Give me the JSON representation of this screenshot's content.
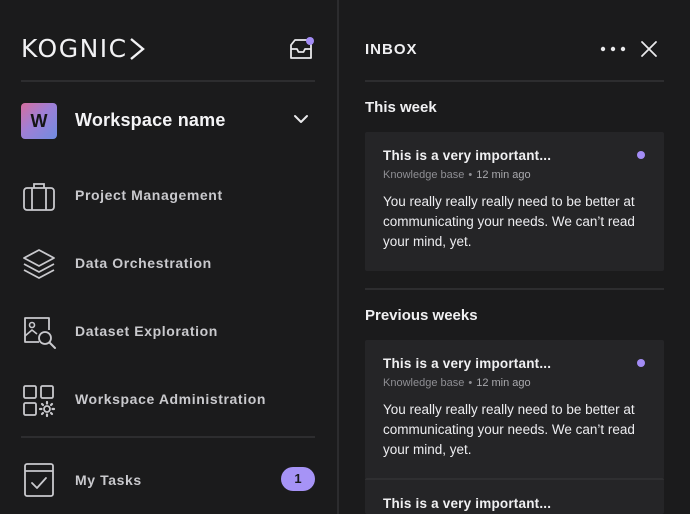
{
  "brand": {
    "logo_text": "KOGNIC"
  },
  "sidebar": {
    "workspace": {
      "initial": "W",
      "name": "Workspace name"
    },
    "nav": [
      {
        "label": "Project Management",
        "icon": "briefcase-icon"
      },
      {
        "label": "Data Orchestration",
        "icon": "layers-icon"
      },
      {
        "label": "Dataset Exploration",
        "icon": "image-search-icon"
      },
      {
        "label": "Workspace Administration",
        "icon": "grid-settings-icon"
      }
    ],
    "tasks": {
      "label": "My Tasks",
      "count": "1",
      "icon": "task-check-icon"
    }
  },
  "inbox": {
    "title": "INBOX",
    "sections": [
      {
        "title": "This week",
        "items": [
          {
            "title": "This is a very important...",
            "source": "Knowledge base",
            "separator": "•",
            "time": "12 min ago",
            "body": "You really really really need to be better at communicating your needs. We can’t read your mind, yet."
          }
        ]
      },
      {
        "title": "Previous weeks",
        "items": [
          {
            "title": "This is a very important...",
            "source": "Knowledge base",
            "separator": "•",
            "time": "12 min ago",
            "body": "You really really really need to be better at communicating your needs. We can’t read your mind, yet."
          },
          {
            "title": "This is a very important..."
          }
        ]
      }
    ]
  },
  "colors": {
    "background": "#1b1b1c",
    "card": "#252527",
    "accent": "#a38cf5",
    "badge": "#a693f6"
  }
}
